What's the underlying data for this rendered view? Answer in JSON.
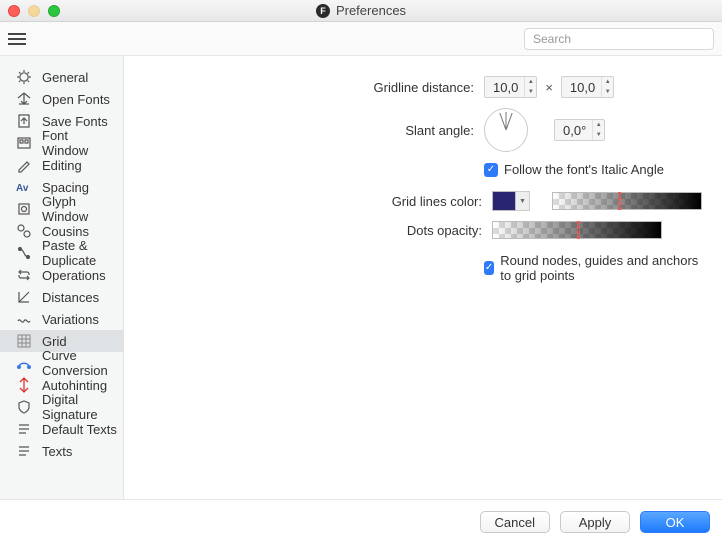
{
  "window": {
    "title": "Preferences"
  },
  "toolbar": {
    "search_placeholder": "Search"
  },
  "sidebar": {
    "items": [
      {
        "label": "General"
      },
      {
        "label": "Open Fonts"
      },
      {
        "label": "Save Fonts"
      },
      {
        "label": "Font Window"
      },
      {
        "label": "Editing"
      },
      {
        "label": "Spacing"
      },
      {
        "label": "Glyph Window"
      },
      {
        "label": "Cousins"
      },
      {
        "label": "Paste & Duplicate"
      },
      {
        "label": "Operations"
      },
      {
        "label": "Distances"
      },
      {
        "label": "Variations"
      },
      {
        "label": "Grid"
      },
      {
        "label": "Curve Conversion"
      },
      {
        "label": "Autohinting"
      },
      {
        "label": "Digital Signature"
      },
      {
        "label": "Default Texts"
      },
      {
        "label": "Texts"
      }
    ],
    "active_index": 12
  },
  "grid": {
    "gridline_distance_label": "Gridline distance:",
    "gridline_x": "10,0",
    "gridline_multiply": "×",
    "gridline_y": "10,0",
    "slant_angle_label": "Slant angle:",
    "slant_angle_value": "0,0°",
    "follow_italic_label": "Follow the font's Italic Angle",
    "follow_italic_checked": true,
    "grid_lines_color_label": "Grid lines color:",
    "grid_lines_color": "#2a2570",
    "dots_opacity_label": "Dots opacity:",
    "round_nodes_label": "Round nodes, guides and anchors to grid points",
    "round_nodes_checked": true
  },
  "footer": {
    "cancel": "Cancel",
    "apply": "Apply",
    "ok": "OK"
  }
}
